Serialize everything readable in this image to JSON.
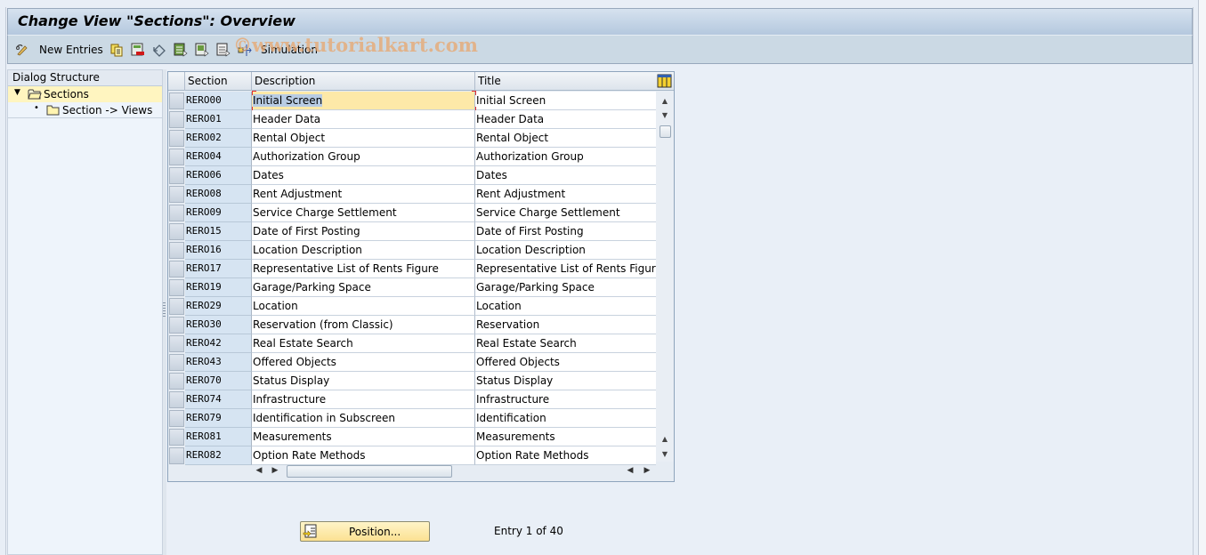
{
  "window": {
    "title": "Change View \"Sections\": Overview"
  },
  "toolbar": {
    "items": [
      {
        "name": "change-display-icon",
        "label": ""
      },
      {
        "name": "new-entries-button",
        "label": "New Entries"
      },
      {
        "name": "copy-as-icon",
        "label": ""
      },
      {
        "name": "delete-icon",
        "label": ""
      },
      {
        "name": "undo-change-icon",
        "label": ""
      },
      {
        "name": "select-all-icon",
        "label": ""
      },
      {
        "name": "select-block-icon",
        "label": ""
      },
      {
        "name": "deselect-all-icon",
        "label": ""
      },
      {
        "name": "simulation-icon",
        "label": ""
      },
      {
        "name": "simulation-button",
        "label": "Simulation"
      }
    ],
    "new_entries_label": "New Entries",
    "simulation_label": "Simulation"
  },
  "watermark": "©www.tutorialkart.com",
  "dialog_structure": {
    "header": "Dialog Structure",
    "items": [
      {
        "label": "Sections",
        "selected": true,
        "expanded": true,
        "level": 0
      },
      {
        "label": "Section -> Views",
        "selected": false,
        "level": 1
      }
    ]
  },
  "table": {
    "columns": [
      "Section",
      "Description",
      "Title"
    ],
    "rows": [
      {
        "section": "RERO00",
        "description": "Initial Screen",
        "title": "Initial Screen"
      },
      {
        "section": "RERO01",
        "description": "Header Data",
        "title": "Header Data"
      },
      {
        "section": "RERO02",
        "description": "Rental Object",
        "title": "Rental Object"
      },
      {
        "section": "RERO04",
        "description": "Authorization Group",
        "title": "Authorization Group"
      },
      {
        "section": "RERO06",
        "description": "Dates",
        "title": "Dates"
      },
      {
        "section": "RERO08",
        "description": "Rent Adjustment",
        "title": "Rent Adjustment"
      },
      {
        "section": "RERO09",
        "description": "Service Charge Settlement",
        "title": "Service Charge Settlement"
      },
      {
        "section": "RERO15",
        "description": "Date of First Posting",
        "title": "Date of First Posting"
      },
      {
        "section": "RERO16",
        "description": "Location Description",
        "title": "Location Description"
      },
      {
        "section": "RERO17",
        "description": "Representative List of Rents Figure",
        "title": "Representative List of Rents Figure"
      },
      {
        "section": "RERO19",
        "description": "Garage/Parking Space",
        "title": "Garage/Parking Space"
      },
      {
        "section": "RERO29",
        "description": "Location",
        "title": "Location"
      },
      {
        "section": "RERO30",
        "description": "Reservation (from Classic)",
        "title": "Reservation"
      },
      {
        "section": "RERO42",
        "description": "Real Estate Search",
        "title": "Real Estate Search"
      },
      {
        "section": "RERO43",
        "description": "Offered Objects",
        "title": "Offered Objects"
      },
      {
        "section": "RERO70",
        "description": "Status Display",
        "title": "Status Display"
      },
      {
        "section": "RERO74",
        "description": "Infrastructure",
        "title": "Infrastructure"
      },
      {
        "section": "RERO79",
        "description": "Identification in Subscreen",
        "title": "Identification"
      },
      {
        "section": "RERO81",
        "description": "Measurements",
        "title": "Measurements"
      },
      {
        "section": "RERO82",
        "description": "Option Rate Methods",
        "title": "Option Rate Methods"
      }
    ]
  },
  "footer": {
    "position_button": "Position...",
    "entry_info": "Entry 1 of 40"
  }
}
